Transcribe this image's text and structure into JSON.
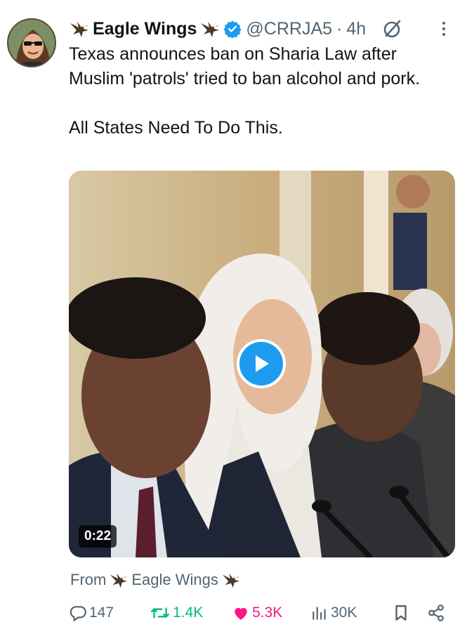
{
  "author": {
    "display_name": "Eagle Wings",
    "handle": "@CRRJA5",
    "separator": "·",
    "time": "4h",
    "verified_color": "#1d9bf0"
  },
  "tweet": {
    "line1": "Texas announces ban on Sharia Law after Muslim 'patrols' tried to ban alcohol and pork.",
    "line2": "All States Need To Do This."
  },
  "media": {
    "duration": "0:22"
  },
  "from": {
    "label": "From",
    "source": "Eagle Wings"
  },
  "metrics": {
    "replies": "147",
    "reposts": "1.4K",
    "likes": "5.3K",
    "views": "30K"
  },
  "colors": {
    "accent": "#1d9bf0",
    "repost": "#00ba7c",
    "like": "#f91880",
    "secondary": "#536471"
  },
  "icons": [
    "eagle-icon",
    "verified-badge-icon",
    "grok-icon",
    "more-icon",
    "play-icon",
    "reply-icon",
    "repost-icon",
    "like-icon",
    "views-icon",
    "bookmark-icon",
    "share-icon"
  ]
}
